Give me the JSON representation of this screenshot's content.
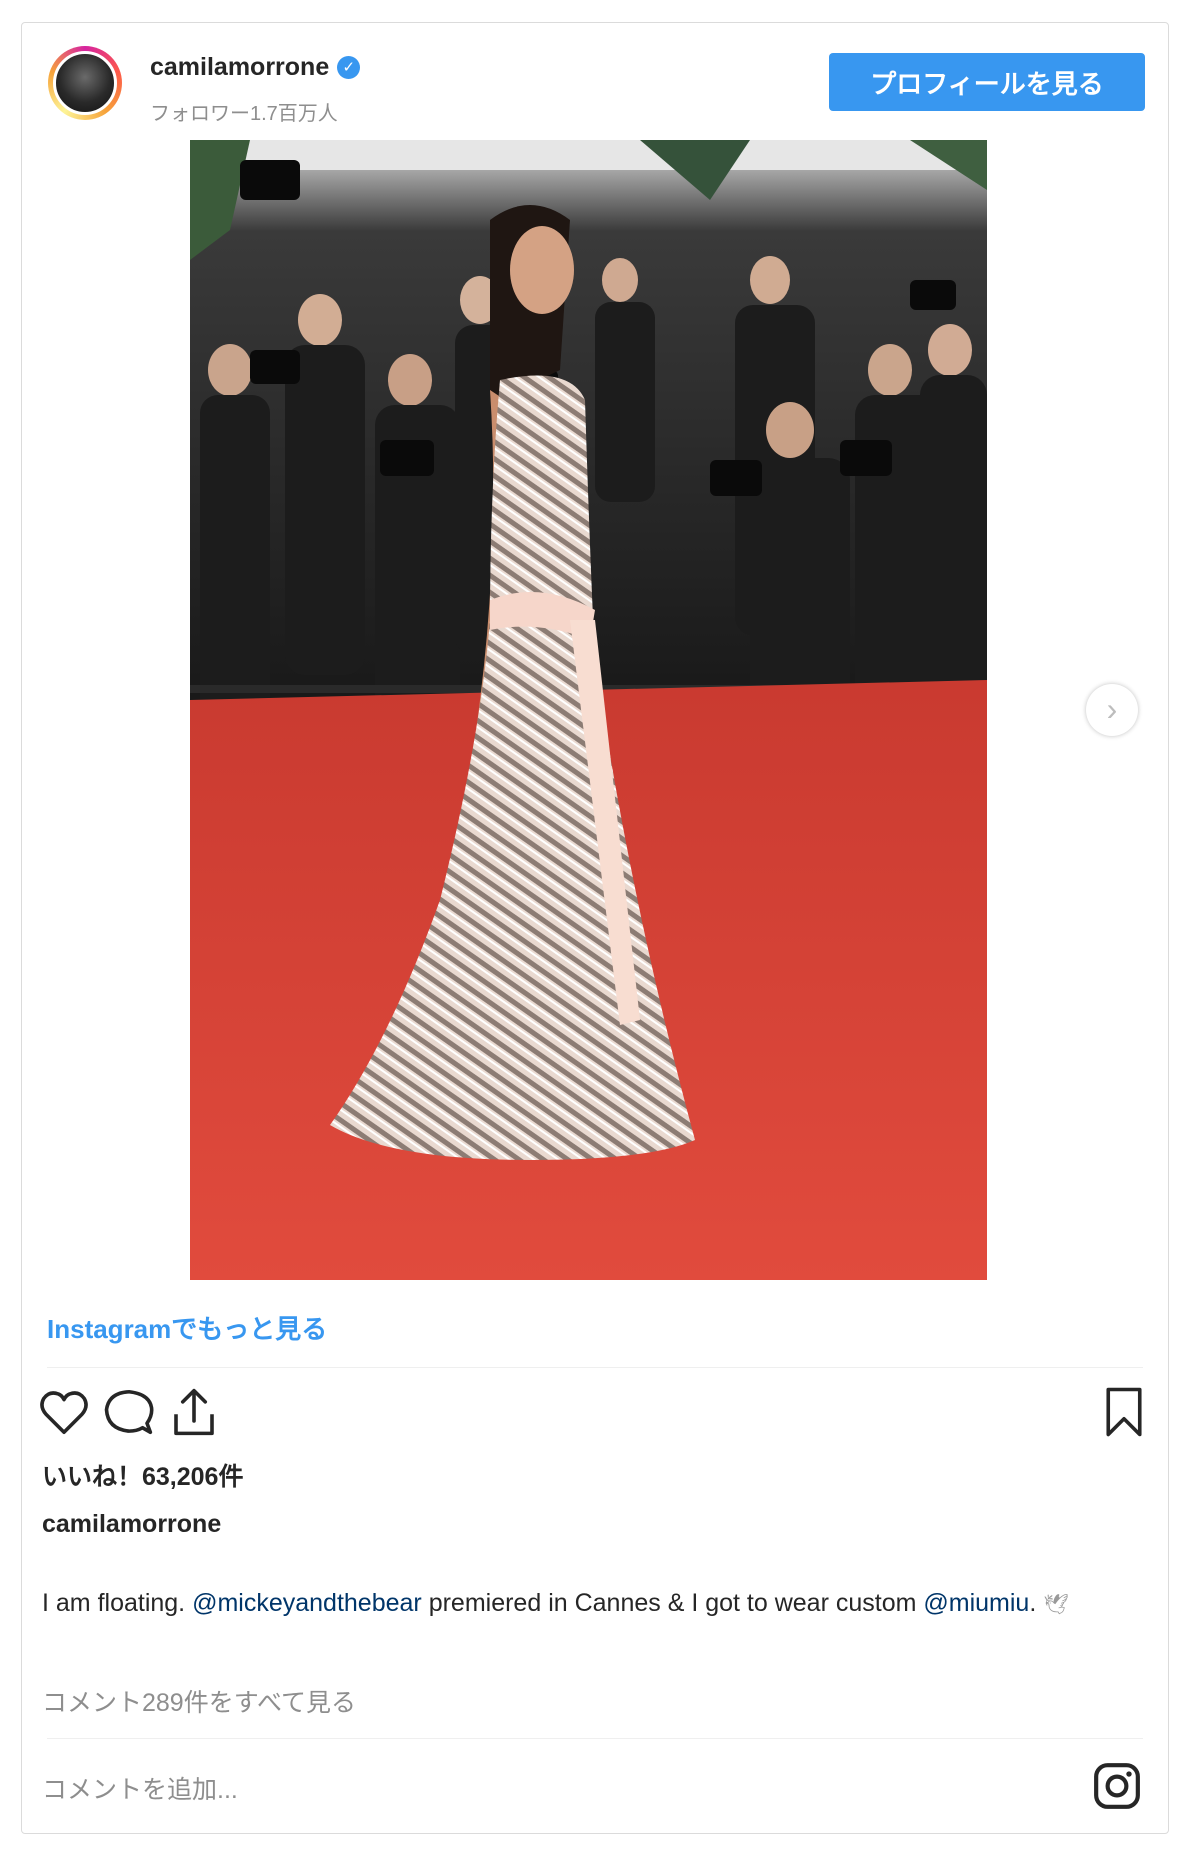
{
  "header": {
    "username": "camilamorrone",
    "followers": "フォロワー1.7百万人",
    "profile_button": "プロフィールを見る"
  },
  "post": {
    "more_link": "Instagramでもっと見る",
    "likes": "いいね！63,206件",
    "caption_user": "camilamorrone",
    "caption_parts": {
      "p1": "I am floating. ",
      "mention1": "@mickeyandthebear",
      "p2": " premiered in Cannes & I got to wear custom ",
      "mention2": "@miumiu",
      "p3": ". ",
      "emoji": "🕊"
    },
    "view_comments": "コメント289件をすべて見る",
    "add_comment": "コメントを追加..."
  },
  "icons": [
    "heart-icon",
    "comment-icon",
    "share-icon",
    "bookmark-icon",
    "instagram-icon",
    "verified-icon",
    "chevron-right-icon"
  ],
  "colors": {
    "accent": "#3897f0",
    "mention": "#003569",
    "muted": "#8e8e8e",
    "carpet": "#e5473a"
  }
}
